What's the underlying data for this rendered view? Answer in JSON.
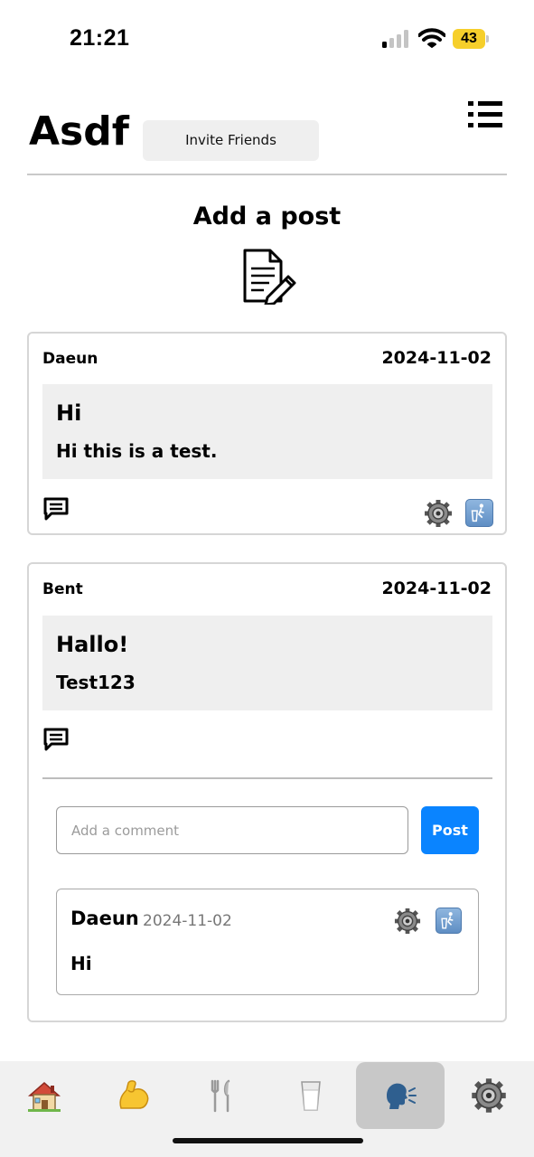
{
  "status_bar": {
    "time": "21:21",
    "battery_level": "43",
    "signal_bars_active": 1,
    "signal_bars_total": 4
  },
  "header": {
    "title": "Asdf",
    "invite_label": "Invite Friends",
    "menu_icon": "list-menu-icon"
  },
  "compose": {
    "title": "Add a post",
    "icon": "compose-post-icon"
  },
  "posts": [
    {
      "author": "Daeun",
      "date": "2024-11-02",
      "title": "Hi",
      "text": "Hi this is a test.",
      "icons": [
        "comment-icon",
        "gear-icon",
        "trash-icon"
      ]
    },
    {
      "author": "Bent",
      "date": "2024-11-02",
      "title": "Hallo!",
      "text": "Test123",
      "icons": [
        "comment-icon"
      ],
      "comment_input": {
        "placeholder": "Add a comment",
        "value": ""
      },
      "post_button_label": "Post",
      "comments": [
        {
          "author": "Daeun",
          "date": "2024-11-02",
          "text": "Hi",
          "icons": [
            "gear-icon",
            "trash-icon"
          ]
        }
      ]
    }
  ],
  "tab_bar": {
    "items": [
      {
        "icon": "house-icon"
      },
      {
        "icon": "flexed-biceps-icon"
      },
      {
        "icon": "fork-and-knife-icon"
      },
      {
        "icon": "glass-of-milk-icon"
      },
      {
        "icon": "speaking-head-icon",
        "active": true
      },
      {
        "icon": "gear-icon"
      }
    ]
  },
  "colors": {
    "accent": "#0a84ff",
    "post_body_bg": "#efefef",
    "tab_bar_bg": "#f1f1f1",
    "active_tab_bg": "#c8c8c8",
    "battery": "#f6cf2b"
  }
}
